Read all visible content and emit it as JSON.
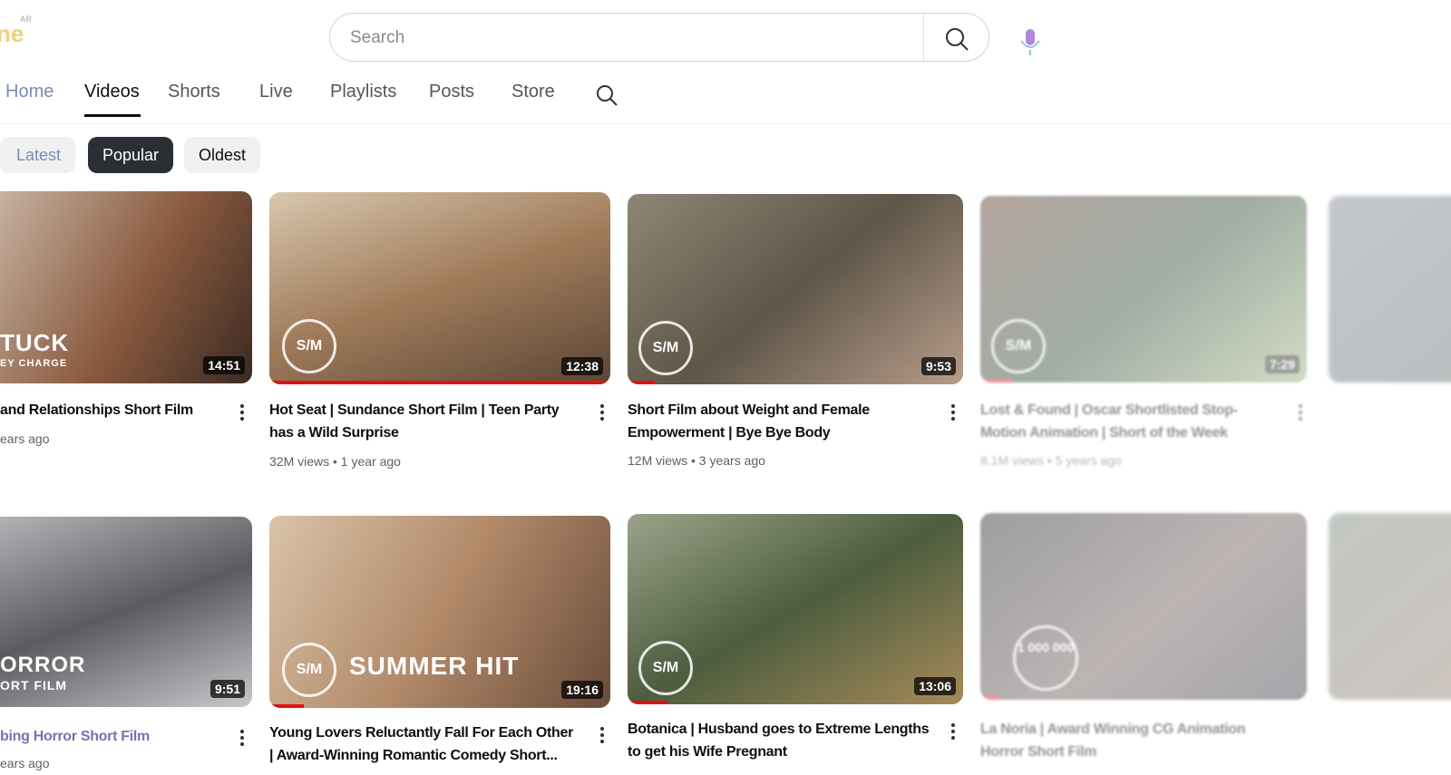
{
  "search": {
    "placeholder": "Search"
  },
  "tabs": [
    "Home",
    "Videos",
    "Shorts",
    "Live",
    "Playlists",
    "Posts",
    "Store"
  ],
  "filters": [
    "Latest",
    "Popular",
    "Oldest"
  ],
  "videos": [
    {
      "title_l1": "and Relationships Short Film",
      "title_l2": "",
      "meta": "ears ago",
      "duration": "14:51",
      "overlay_l1": "TUCK",
      "overlay_l2": "EY CHARGE"
    },
    {
      "title_l1": "Hot Seat | Sundance Short Film | Teen Party",
      "title_l2": "has a Wild Surprise",
      "meta": "32M views • 1 year ago",
      "duration": "12:38",
      "badge": "S/M"
    },
    {
      "title_l1": "Short Film about Weight and Female",
      "title_l2": "Empowerment | Bye Bye Body",
      "meta": "12M views • 3 years ago",
      "duration": "9:53"
    },
    {
      "title_l1": "Lost & Found | Oscar Shortlisted Stop-",
      "title_l2": "Motion Animation | Short of the Week",
      "meta": "8.1M views • 5 years ago",
      "duration": "7:29"
    },
    {
      "title_l1": "bing Horror Short Film",
      "title_l2": "",
      "meta": "ears ago",
      "duration": "9:51",
      "overlay_l1": "ORROR",
      "overlay_l2": "ORT FILM"
    },
    {
      "title_l1": "Young Lovers Reluctantly Fall For Each Other",
      "title_l2": "| Award-Winning Romantic Comedy Short...",
      "meta": "",
      "duration": "19:16",
      "overlay_l1": "SUMMER HIT",
      "overlay_l2": ""
    },
    {
      "title_l1": "Botanica | Husband goes to Extreme Lengths",
      "title_l2": "to get his Wife Pregnant",
      "meta": "",
      "duration": "13:06",
      "badge": "S/M"
    },
    {
      "title_l1": "La Noria | Award Winning CG Animation",
      "title_l2": "Horror Short Film",
      "meta": "",
      "duration": "",
      "badge_text": "1 000 000"
    }
  ],
  "colors": {
    "accent": "#e01212",
    "chip_active": "#2a2f36"
  }
}
